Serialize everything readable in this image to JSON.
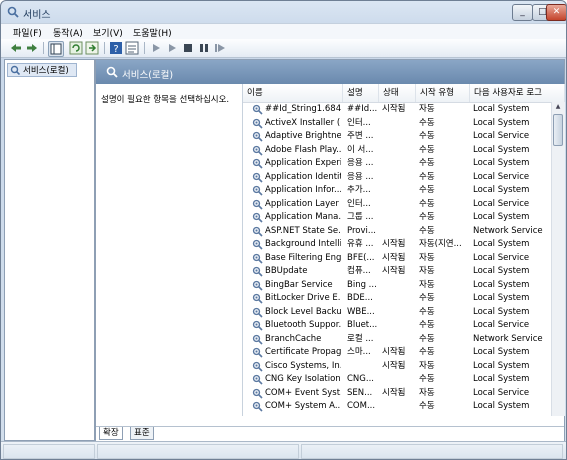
{
  "window": {
    "title": "서비스"
  },
  "menu": [
    "파일(F)",
    "동작(A)",
    "보기(V)",
    "도움말(H)"
  ],
  "toolbar_icons": [
    "back-arrow-icon",
    "forward-arrow-icon",
    "show-tree-icon",
    "refresh-icon",
    "export-icon",
    "help-icon",
    "properties-icon",
    "start-icon",
    "play-icon",
    "stop-icon",
    "pause-icon",
    "restart-icon"
  ],
  "tree": {
    "root_label": "서비스(로컬)"
  },
  "main": {
    "header_title": "서비스(로컬)",
    "description_prompt": "설명이 필요한 항목을 선택하십시오.",
    "columns": [
      "이름",
      "설명",
      "상태",
      "시작 유형",
      "다음 사용자로 로그"
    ],
    "rows": [
      {
        "name": "##Id_String1.684...",
        "desc": "##Id...",
        "status": "시작됨",
        "type": "자동",
        "logon": "Local System"
      },
      {
        "name": "ActiveX Installer (...",
        "desc": "인터...",
        "status": "",
        "type": "수동",
        "logon": "Local System"
      },
      {
        "name": "Adaptive Brightness",
        "desc": "주변 ...",
        "status": "",
        "type": "수동",
        "logon": "Local Service"
      },
      {
        "name": "Adobe Flash Play...",
        "desc": "이 서...",
        "status": "",
        "type": "수동",
        "logon": "Local System"
      },
      {
        "name": "Application Experi...",
        "desc": "응용 ...",
        "status": "",
        "type": "수동",
        "logon": "Local System"
      },
      {
        "name": "Application Identity",
        "desc": "응용 ...",
        "status": "",
        "type": "수동",
        "logon": "Local Service"
      },
      {
        "name": "Application Infor...",
        "desc": "추가...",
        "status": "",
        "type": "수동",
        "logon": "Local System"
      },
      {
        "name": "Application Layer ...",
        "desc": "인터...",
        "status": "",
        "type": "수동",
        "logon": "Local Service"
      },
      {
        "name": "Application Mana...",
        "desc": "그룹 ...",
        "status": "",
        "type": "수동",
        "logon": "Local System"
      },
      {
        "name": "ASP.NET State Se...",
        "desc": "Provi...",
        "status": "",
        "type": "수동",
        "logon": "Network Service"
      },
      {
        "name": "Background Intelli...",
        "desc": "유휴 ...",
        "status": "시작됨",
        "type": "자동(지연...",
        "logon": "Local System"
      },
      {
        "name": "Base Filtering Eng...",
        "desc": "BFE(...",
        "status": "시작됨",
        "type": "자동",
        "logon": "Local Service"
      },
      {
        "name": "BBUpdate",
        "desc": "컴퓨...",
        "status": "시작됨",
        "type": "자동",
        "logon": "Local System"
      },
      {
        "name": "BingBar Service",
        "desc": "Bing ...",
        "status": "",
        "type": "자동",
        "logon": "Local System"
      },
      {
        "name": "BitLocker Drive E...",
        "desc": "BDE...",
        "status": "",
        "type": "수동",
        "logon": "Local System"
      },
      {
        "name": "Block Level Backu...",
        "desc": "WBE...",
        "status": "",
        "type": "수동",
        "logon": "Local System"
      },
      {
        "name": "Bluetooth Suppor...",
        "desc": "Bluet...",
        "status": "",
        "type": "수동",
        "logon": "Local Service"
      },
      {
        "name": "BranchCache",
        "desc": "로컬 ...",
        "status": "",
        "type": "수동",
        "logon": "Network Service"
      },
      {
        "name": "Certificate Propag...",
        "desc": "스마...",
        "status": "시작됨",
        "type": "수동",
        "logon": "Local System"
      },
      {
        "name": "Cisco Systems, In...",
        "desc": "",
        "status": "시작됨",
        "type": "자동",
        "logon": "Local System"
      },
      {
        "name": "CNG Key Isolation",
        "desc": "CNG...",
        "status": "",
        "type": "수동",
        "logon": "Local System"
      },
      {
        "name": "COM+ Event Syst...",
        "desc": "SEN...",
        "status": "시작됨",
        "type": "자동",
        "logon": "Local Service"
      },
      {
        "name": "COM+ System A...",
        "desc": "COM...",
        "status": "",
        "type": "수동",
        "logon": "Local System"
      }
    ]
  },
  "tabs": [
    "확장",
    "표준"
  ],
  "colors": {
    "accent": "#6a89ad",
    "window_frame": "#c9d8ea"
  }
}
